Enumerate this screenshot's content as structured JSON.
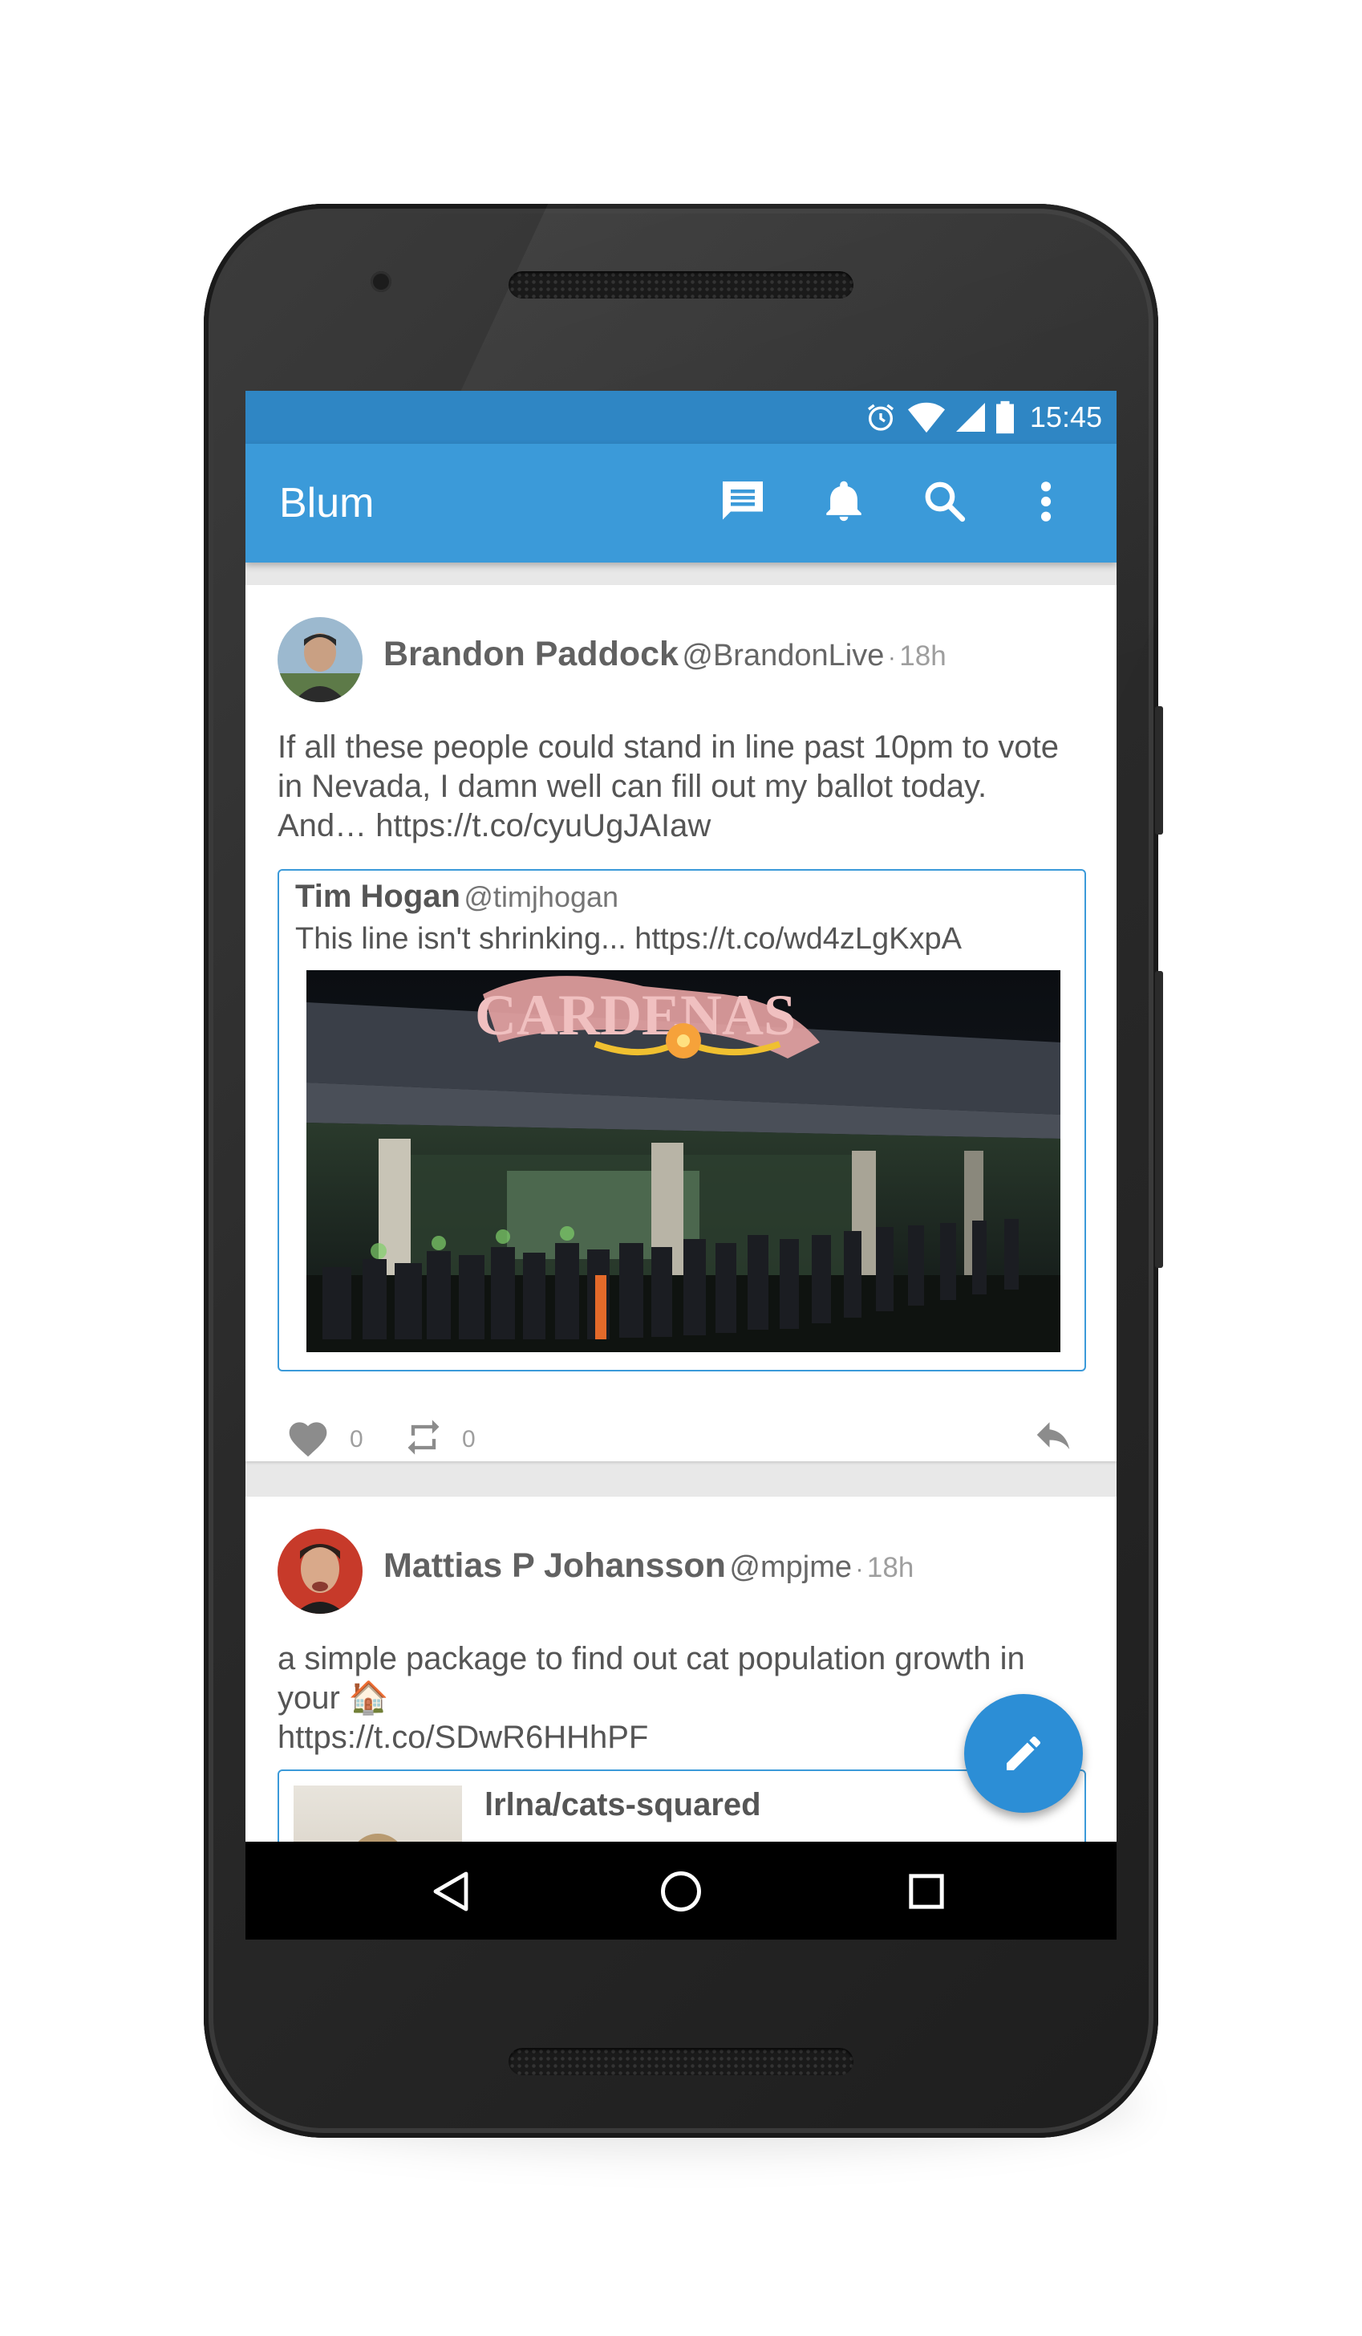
{
  "status_bar": {
    "time": "15:45",
    "icons": [
      "alarm-icon",
      "wifi-icon",
      "signal-icon",
      "battery-icon"
    ]
  },
  "app_bar": {
    "title": "Blum",
    "actions": [
      "messages-icon",
      "notifications-icon",
      "search-icon",
      "overflow-menu-icon"
    ]
  },
  "tweets": [
    {
      "author": "Brandon Paddock",
      "handle": "@BrandonLive",
      "separator": "·",
      "time": "18h",
      "text": "If all these people could stand in line past 10pm to vote in Nevada, I damn well can fill out my ballot today. And… https://t.co/cyuUgJAIaw",
      "quote": {
        "author": "Tim Hogan",
        "handle": "@timjhogan",
        "text": "This line isn't shrinking... https://t.co/wd4zLgKxpA",
        "image_sign_text": "CARDENAS"
      },
      "likes": "0",
      "retweets": "0"
    },
    {
      "author": "Mattias P Johansson",
      "handle": "@mpjme",
      "separator": "·",
      "time": "18h",
      "text_line1": "a simple package to find out cat population growth in",
      "text_line2": "your 🏠",
      "text_line3": "https://t.co/SDwR6HHhPF",
      "link_card_title": "lrlna/cats-squared"
    }
  ],
  "fab": {
    "icon": "compose-icon"
  },
  "nav_bar": {
    "buttons": [
      "back-icon",
      "home-icon",
      "recents-icon"
    ]
  },
  "colors": {
    "status_bar": "#2f86c4",
    "app_bar": "#3b9ad9",
    "fab": "#2c8ed6",
    "quote_border": "#3b9ad9"
  }
}
